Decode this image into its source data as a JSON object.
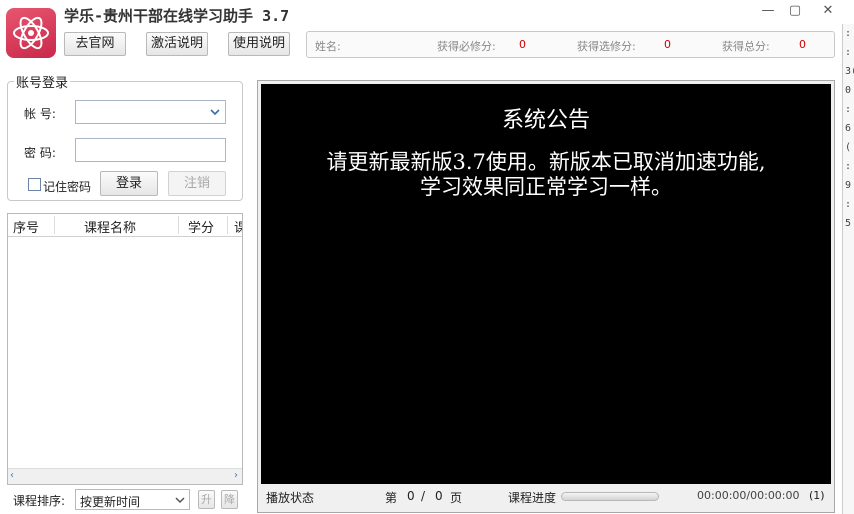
{
  "window": {
    "title": "学乐-贵州干部在线学习助手 3.7",
    "minimize_glyph": "—",
    "maximize_glyph": "▢",
    "close_glyph": "✕",
    "icon": "atom-logo-icon"
  },
  "toolbar": {
    "website_label": "去官网",
    "activation_label": "激活说明",
    "usage_label": "使用说明"
  },
  "info": {
    "name_label": "姓名:",
    "name_value": "",
    "required_label": "获得必修分:",
    "required_value": "0",
    "elective_label": "获得选修分:",
    "elective_value": "0",
    "total_label": "获得总分:",
    "total_value": "0"
  },
  "login": {
    "legend": "账号登录",
    "account_label": "帐  号:",
    "account_value": "",
    "password_label": "密  码:",
    "password_value": "",
    "remember_label": "记住密码",
    "remember_checked": false,
    "login_label": "登录",
    "logout_label": "注销"
  },
  "course_table": {
    "columns": [
      "序号",
      "课程名称",
      "学分",
      "课"
    ],
    "rows": []
  },
  "sort": {
    "label": "课程排序:",
    "selected": "按更新时间",
    "up_label": "升",
    "down_label": "降"
  },
  "notice": {
    "title": "系统公告",
    "line1": "请更新最新版3.7使用。新版本已取消加速功能,",
    "line2": "学习效果同正常学习一样。"
  },
  "player": {
    "state_label": "播放状态",
    "page_prefix": "第",
    "page_current": "0",
    "page_sep": "/",
    "page_total": "0",
    "page_suffix": "页",
    "progress_label": "课程进度",
    "progress": 0,
    "time": "00:00:00/00:00:00",
    "badge": "(1)"
  },
  "right_strip": [
    ":",
    ":",
    "3(",
    "0",
    ":",
    "6",
    "(",
    ":",
    "9",
    ":",
    "5"
  ],
  "colors": {
    "accent": "#d40000",
    "icon_bg": "#d63a58",
    "screen_bg": "#000000"
  }
}
